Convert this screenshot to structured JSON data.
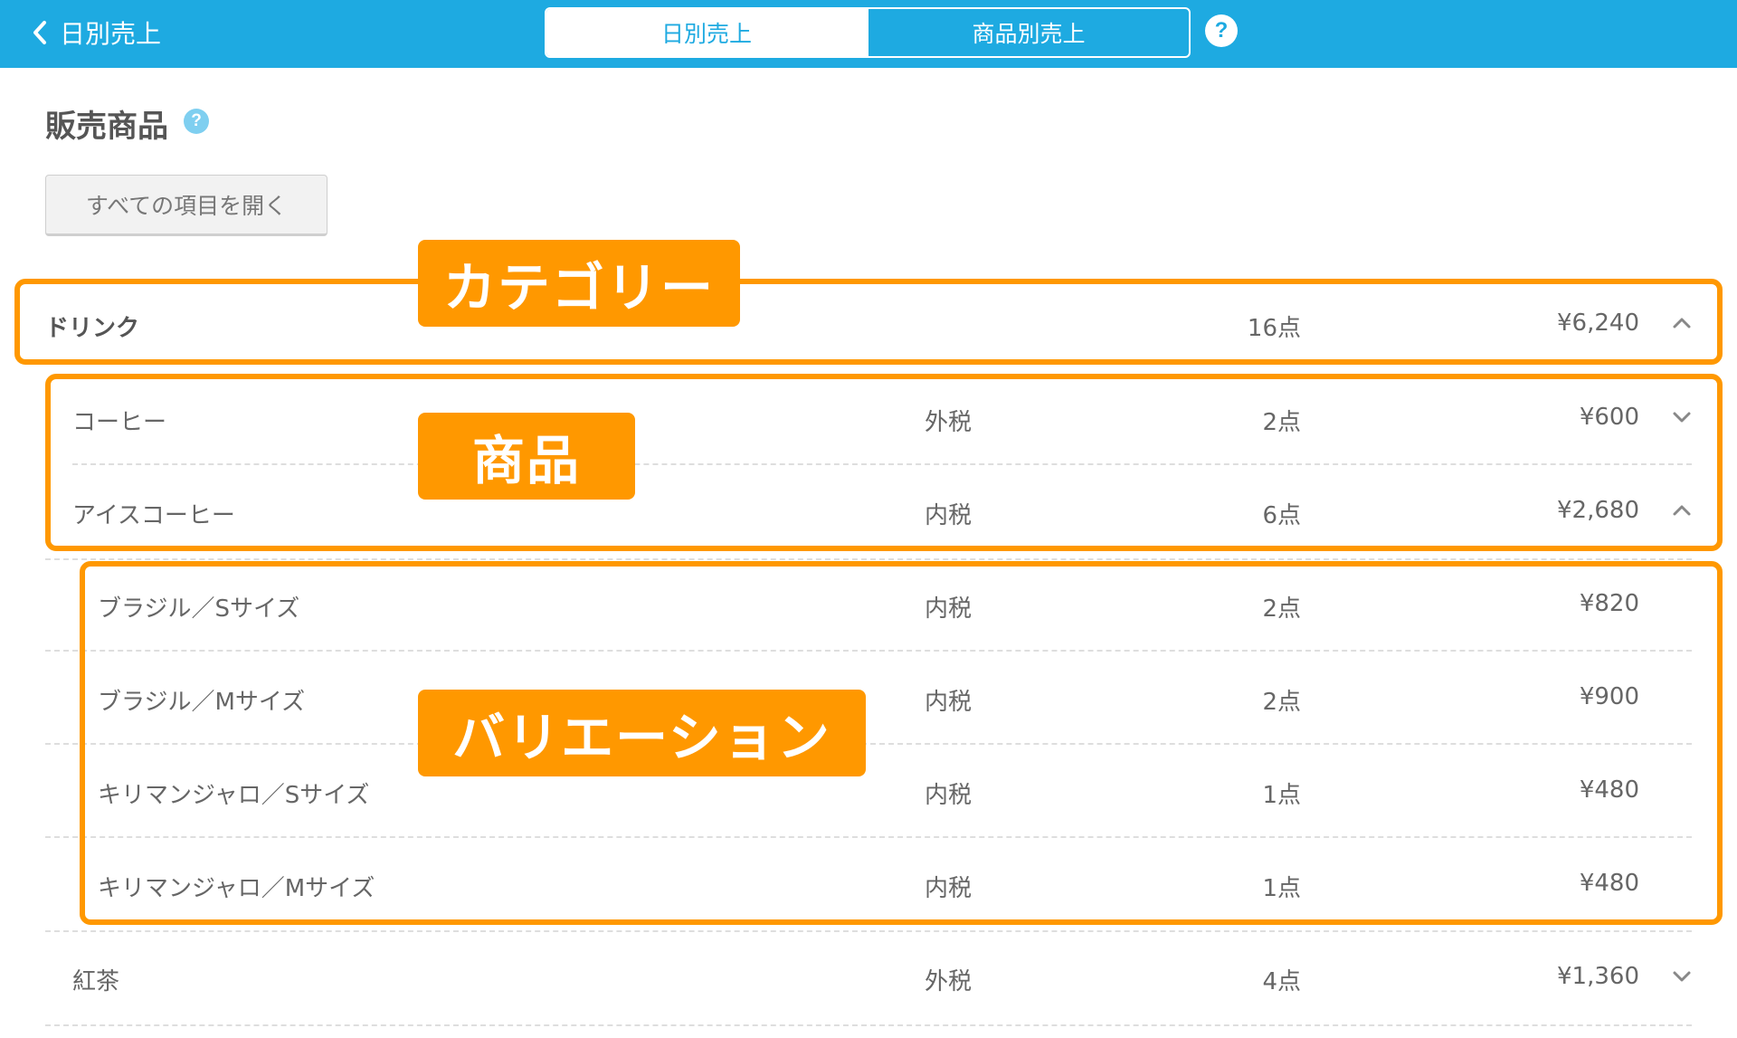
{
  "header": {
    "back_label": "日別売上",
    "tabs": [
      {
        "label": "日別売上",
        "active": true
      },
      {
        "label": "商品別売上",
        "active": false
      }
    ],
    "help": "?",
    "accent_color": "#1eaae1"
  },
  "section": {
    "title": "販売商品",
    "help": "?",
    "open_all_label": "すべての項目を開く"
  },
  "category": {
    "name": "ドリンク",
    "qty": "16点",
    "amount": "¥6,240",
    "expanded": true
  },
  "products": [
    {
      "name": "コーヒー",
      "tax": "外税",
      "qty": "2点",
      "amount": "¥600",
      "expanded": false
    },
    {
      "name": "アイスコーヒー",
      "tax": "内税",
      "qty": "6点",
      "amount": "¥2,680",
      "expanded": true
    }
  ],
  "variations": [
    {
      "name": "ブラジル／Sサイズ",
      "tax": "内税",
      "qty": "2点",
      "amount": "¥820"
    },
    {
      "name": "ブラジル／Mサイズ",
      "tax": "内税",
      "qty": "2点",
      "amount": "¥900"
    },
    {
      "name": "キリマンジャロ／Sサイズ",
      "tax": "内税",
      "qty": "1点",
      "amount": "¥480"
    },
    {
      "name": "キリマンジャロ／Mサイズ",
      "tax": "内税",
      "qty": "1点",
      "amount": "¥480"
    }
  ],
  "next_product": {
    "name": "紅茶",
    "tax": "外税",
    "qty": "4点",
    "amount": "¥1,360",
    "expanded": false
  },
  "annotations": {
    "category_label": "カテゴリー",
    "product_label": "商品",
    "variation_label": "バリエーション",
    "color": "#ff9800"
  },
  "icons": {
    "back": "chevron-left-icon",
    "expanded": "chevron-up-icon",
    "collapsed": "chevron-down-icon"
  }
}
